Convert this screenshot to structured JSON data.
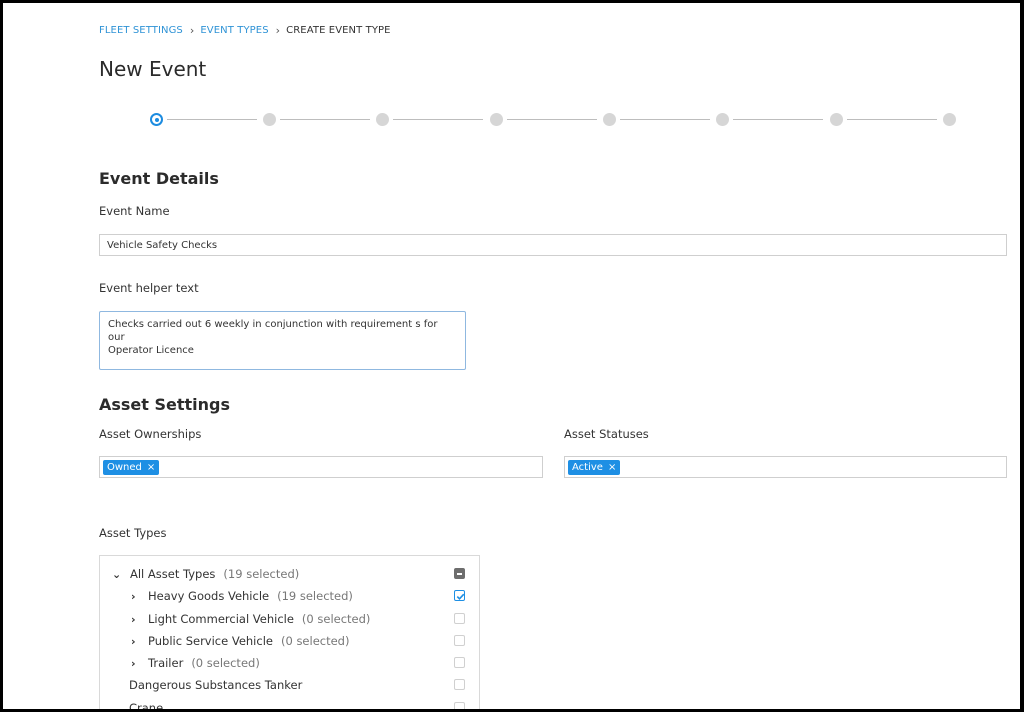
{
  "breadcrumb": {
    "items": [
      "FLEET SETTINGS",
      "EVENT TYPES"
    ],
    "current": "CREATE EVENT TYPE"
  },
  "page_title": "New Event",
  "stepper": {
    "total_steps": 8,
    "active_step": 1
  },
  "event_details": {
    "title": "Event Details",
    "name_label": "Event Name",
    "name_value": "Vehicle Safety Checks",
    "helper_label": "Event helper text",
    "helper_value_line1": "Checks carried out 6 weekly in conjunction with requirement s for our",
    "helper_value_line2": "Operator Licence"
  },
  "asset_settings": {
    "title": "Asset Settings",
    "ownerships_label": "Asset Ownerships",
    "ownerships_tags": [
      "Owned"
    ],
    "statuses_label": "Asset Statuses",
    "statuses_tags": [
      "Active"
    ],
    "tag_remove_glyph": "×"
  },
  "asset_types": {
    "label": "Asset Types",
    "root": {
      "name": "All Asset Types",
      "count": "(19 selected)",
      "state": "indeterminate"
    },
    "groups": [
      {
        "name": "Heavy Goods Vehicle",
        "count": "(19 selected)",
        "state": "checked"
      },
      {
        "name": "Light Commercial Vehicle",
        "count": "(0 selected)",
        "state": "unchecked"
      },
      {
        "name": "Public Service Vehicle",
        "count": "(0 selected)",
        "state": "unchecked"
      },
      {
        "name": "Trailer",
        "count": "(0 selected)",
        "state": "unchecked"
      }
    ],
    "items": [
      {
        "name": "Dangerous Substances Tanker",
        "state": "unchecked"
      },
      {
        "name": "Crane",
        "state": "unchecked"
      }
    ]
  },
  "colors": {
    "accent": "#1e8fe4",
    "breadcrumb_link": "#2f93d6",
    "indeterminate": "#6d6d6d"
  }
}
